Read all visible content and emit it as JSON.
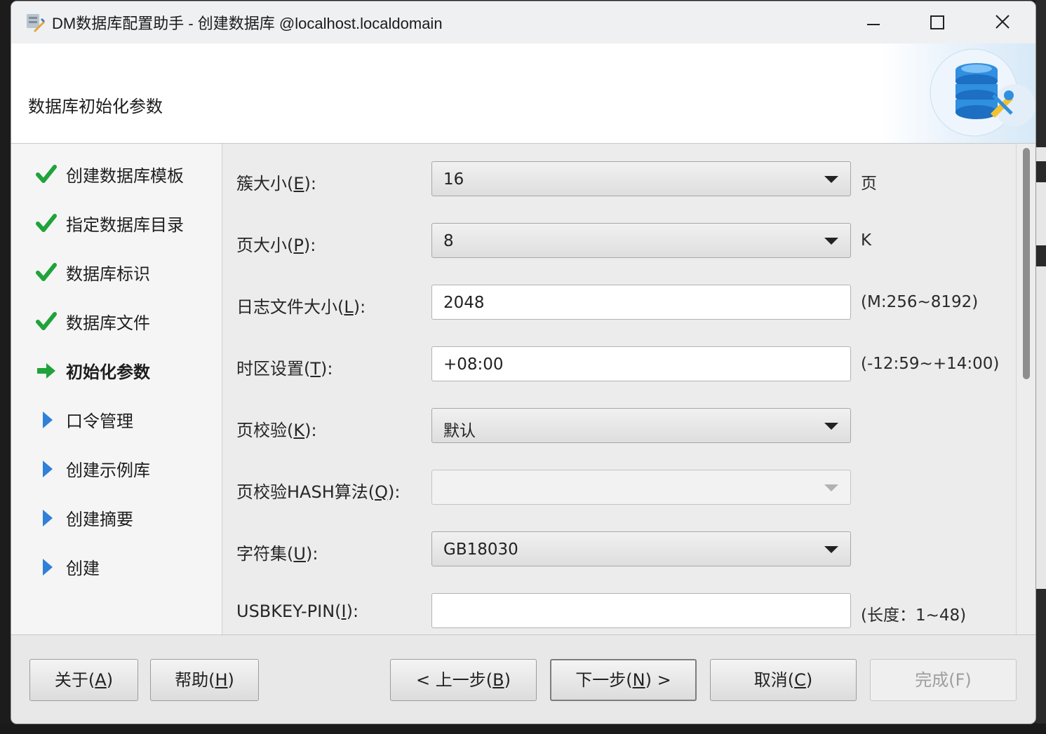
{
  "window": {
    "title": "DM数据库配置助手 - 创建数据库 @localhost.localdomain",
    "app_icon": "dm-config-tool-icon"
  },
  "header": {
    "title": "数据库初始化参数",
    "logo_icon": "database-wrench-icon"
  },
  "steps": [
    {
      "label": "创建数据库模板",
      "state": "done",
      "icon": "check-icon"
    },
    {
      "label": "指定数据库目录",
      "state": "done",
      "icon": "check-icon"
    },
    {
      "label": "数据库标识",
      "state": "done",
      "icon": "check-icon"
    },
    {
      "label": "数据库文件",
      "state": "done",
      "icon": "check-icon"
    },
    {
      "label": "初始化参数",
      "state": "current",
      "icon": "arrow-right-icon"
    },
    {
      "label": "口令管理",
      "state": "pending",
      "icon": "triangle-right-icon"
    },
    {
      "label": "创建示例库",
      "state": "pending",
      "icon": "triangle-right-icon"
    },
    {
      "label": "创建摘要",
      "state": "pending",
      "icon": "triangle-right-icon"
    },
    {
      "label": "创建",
      "state": "pending",
      "icon": "triangle-right-icon"
    }
  ],
  "fields": {
    "extent_size": {
      "label_pre": "簇大小(",
      "mnemonic": "E",
      "label_post": "):",
      "value": "16",
      "suffix": "页"
    },
    "page_size": {
      "label_pre": "页大小(",
      "mnemonic": "P",
      "label_post": "):",
      "value": "8",
      "suffix": "K"
    },
    "log_size": {
      "label_pre": "日志文件大小(",
      "mnemonic": "L",
      "label_post": "):",
      "value": "2048",
      "suffix": "(M:256~8192)"
    },
    "time_zone": {
      "label_pre": "时区设置(",
      "mnemonic": "T",
      "label_post": "):",
      "value": "+08:00",
      "suffix": "(-12:59~+14:00)"
    },
    "page_check": {
      "label_pre": "页校验(",
      "mnemonic": "K",
      "label_post": "):",
      "value": "默认",
      "suffix": ""
    },
    "page_hash": {
      "label_pre": "页校验HASH算法(",
      "mnemonic": "Q",
      "label_post": "):",
      "value": "",
      "suffix": ""
    },
    "charset": {
      "label_pre": "字符集(",
      "mnemonic": "U",
      "label_post": "):",
      "value": "GB18030",
      "suffix": ""
    },
    "usbkey_pin": {
      "label_pre": "USBKEY-PIN(",
      "mnemonic": "I",
      "label_post": "):",
      "value": "",
      "suffix": "(长度：1~48)"
    }
  },
  "buttons": {
    "about": {
      "pre": "关于(",
      "mn": "A",
      "post": ")"
    },
    "help": {
      "pre": "帮助(",
      "mn": "H",
      "post": ")"
    },
    "back": {
      "pre": "< 上一步(",
      "mn": "B",
      "post": ")"
    },
    "next": {
      "pre": "下一步(",
      "mn": "N",
      "post": ") >"
    },
    "cancel": {
      "pre": "取消(",
      "mn": "C",
      "post": ")"
    },
    "finish": {
      "pre": "完成(",
      "mn": "F",
      "post": ")"
    }
  },
  "colors": {
    "check": "#1fa33a",
    "arrow": "#1fa33a",
    "triangle": "#2f80d8",
    "banner_logo": "#2f8fe0"
  }
}
